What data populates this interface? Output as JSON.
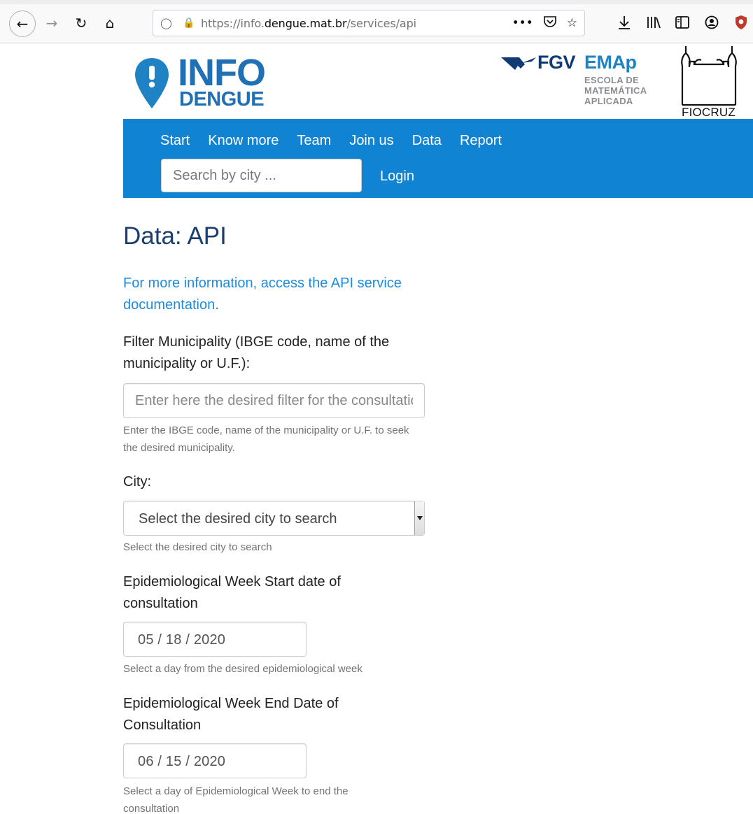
{
  "browser": {
    "url_prefix": "https://info.",
    "url_domain": "dengue.mat.br",
    "url_path": "/services/api",
    "more_label": "•••"
  },
  "header": {
    "logo_info_word": "INFO",
    "logo_dengue_word": "DENGUE",
    "logo_fgv_word": "FGV",
    "logo_emap_word": "EMAp",
    "logo_escola_line1": "ESCOLA DE",
    "logo_escola_line2": "MATEMÁTICA",
    "logo_escola_line3": "APLICADA",
    "logo_fiocruz_word": "FIOCRUZ"
  },
  "nav": {
    "items": [
      "Start",
      "Know more",
      "Team",
      "Join us",
      "Data",
      "Report"
    ],
    "search_placeholder": "Search by city ...",
    "login_label": "Login"
  },
  "main": {
    "title": "Data: API",
    "doc_link": "For more information, access the API service documentation.",
    "filter": {
      "label": "Filter Municipality (IBGE code, name of the municipality or U.F.):",
      "placeholder": "Enter here the desired filter for the consultation",
      "help": "Enter the IBGE code, name of the municipality or U.F. to seek the desired municipality."
    },
    "city": {
      "label": "City:",
      "selected": "Select the desired city to search",
      "help": "Select the desired city to search"
    },
    "start_week": {
      "label": "Epidemiological Week Start date of consultation",
      "value": "05 / 18 / 2020",
      "help": "Select a day from the desired epidemiological week"
    },
    "end_week": {
      "label": "Epidemiological Week End Date of Consultation",
      "value": "06 / 15 / 2020",
      "help": "Select a day of Epidemiological Week to end the consultation"
    }
  },
  "colors": {
    "navbar": "#1183d3",
    "title": "#1a3f6e",
    "link": "#1d8ce0",
    "logo_blue": "#1f70b5"
  }
}
